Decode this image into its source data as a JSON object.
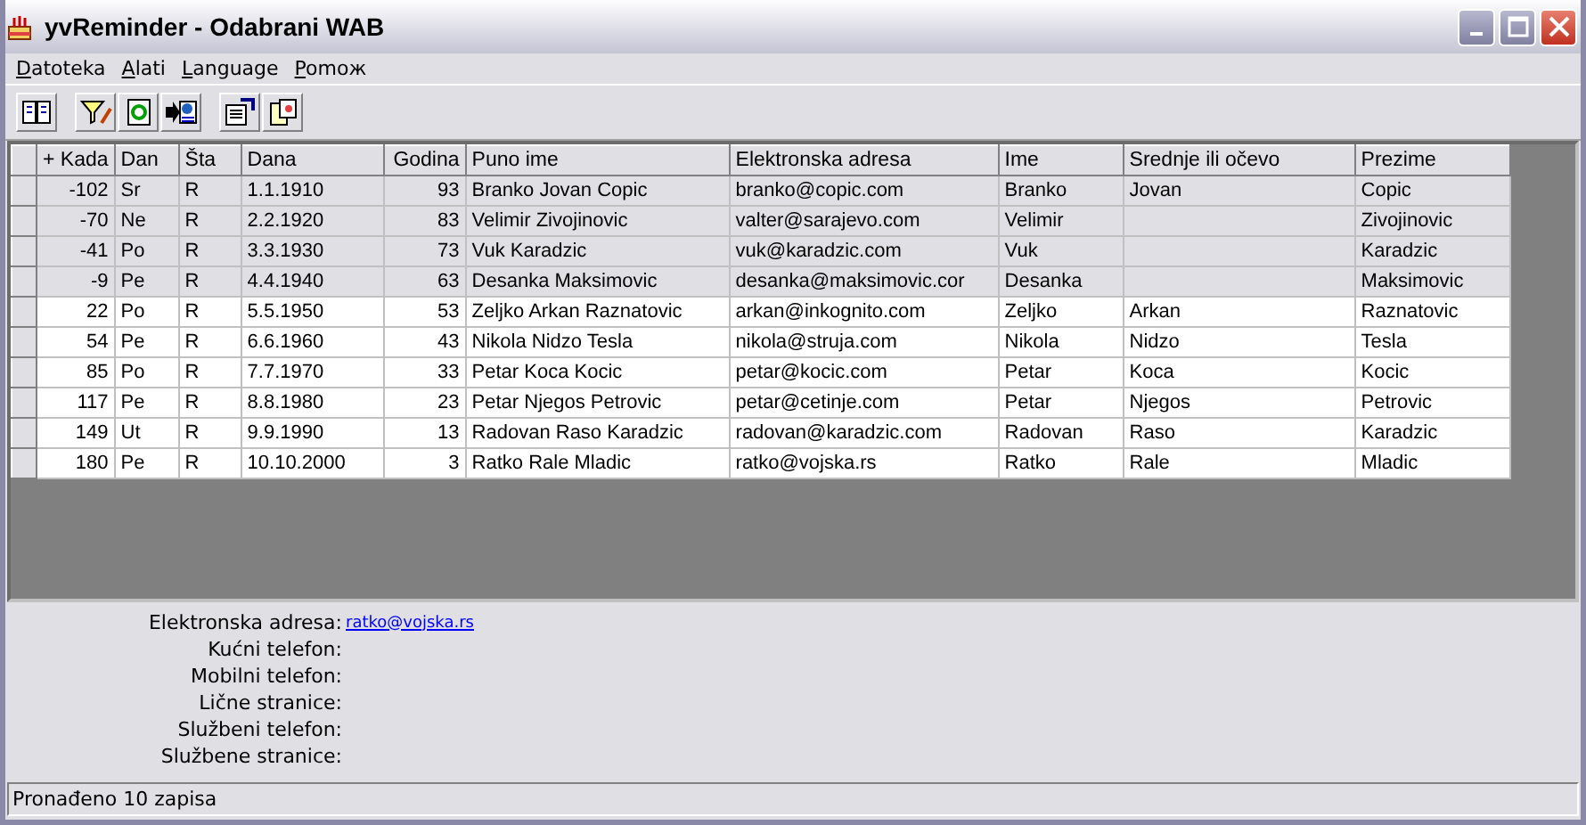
{
  "window": {
    "title": "yvReminder - Odabrani WAB"
  },
  "menu": [
    "Datoteka",
    "Alati",
    "Language",
    "Pomoж"
  ],
  "table": {
    "columns": [
      "+ Kada",
      "Dan",
      "Šta",
      "Dana",
      "Godina",
      "Puno ime",
      "Elektronska adresa",
      "Ime",
      "Srednje ili očevo",
      "Prezime"
    ],
    "rows": [
      {
        "past": true,
        "cells": [
          "-102",
          "Sr",
          "R",
          "1.1.1910",
          "93",
          "Branko Jovan Copic",
          "branko@copic.com",
          "Branko",
          "Jovan",
          "Copic"
        ]
      },
      {
        "past": true,
        "cells": [
          "-70",
          "Ne",
          "R",
          "2.2.1920",
          "83",
          "Velimir Zivojinovic",
          "valter@sarajevo.com",
          "Velimir",
          "",
          "Zivojinovic"
        ]
      },
      {
        "past": true,
        "cells": [
          "-41",
          "Po",
          "R",
          "3.3.1930",
          "73",
          "Vuk Karadzic",
          "vuk@karadzic.com",
          "Vuk",
          "",
          "Karadzic"
        ]
      },
      {
        "past": true,
        "cells": [
          "-9",
          "Pe",
          "R",
          "4.4.1940",
          "63",
          "Desanka Maksimovic",
          "desanka@maksimovic.cor",
          "Desanka",
          "",
          "Maksimovic"
        ]
      },
      {
        "past": false,
        "cells": [
          "22",
          "Po",
          "R",
          "5.5.1950",
          "53",
          "Zeljko Arkan Raznatovic",
          "arkan@inkognito.com",
          "Zeljko",
          "Arkan",
          "Raznatovic"
        ]
      },
      {
        "past": false,
        "cells": [
          "54",
          "Pe",
          "R",
          "6.6.1960",
          "43",
          "Nikola Nidzo Tesla",
          "nikola@struja.com",
          "Nikola",
          "Nidzo",
          "Tesla"
        ]
      },
      {
        "past": false,
        "cells": [
          "85",
          "Po",
          "R",
          "7.7.1970",
          "33",
          "Petar Koca Kocic",
          "petar@kocic.com",
          "Petar",
          "Koca",
          "Kocic"
        ]
      },
      {
        "past": false,
        "cells": [
          "117",
          "Pe",
          "R",
          "8.8.1980",
          "23",
          "Petar Njegos Petrovic",
          "petar@cetinje.com",
          "Petar",
          "Njegos",
          "Petrovic"
        ]
      },
      {
        "past": false,
        "cells": [
          "149",
          "Ut",
          "R",
          "9.9.1990",
          "13",
          "Radovan Raso Karadzic",
          "radovan@karadzic.com",
          "Radovan",
          "Raso",
          "Karadzic"
        ]
      },
      {
        "past": false,
        "cells": [
          "180",
          "Pe",
          "R",
          "10.10.2000",
          "3",
          "Ratko Rale Mladic",
          "ratko@vojska.rs",
          "Ratko",
          "Rale",
          "Mladic"
        ]
      }
    ]
  },
  "details": [
    {
      "label": "Elektronska adresa:",
      "link": "ratko@vojska.rs"
    },
    {
      "label": "Kućni telefon:"
    },
    {
      "label": "Mobilni telefon:"
    },
    {
      "label": "Lične stranice:"
    },
    {
      "label": "Službeni telefon:"
    },
    {
      "label": "Službene stranice:"
    }
  ],
  "status_bar": "Pronađeno 10 zapisa"
}
